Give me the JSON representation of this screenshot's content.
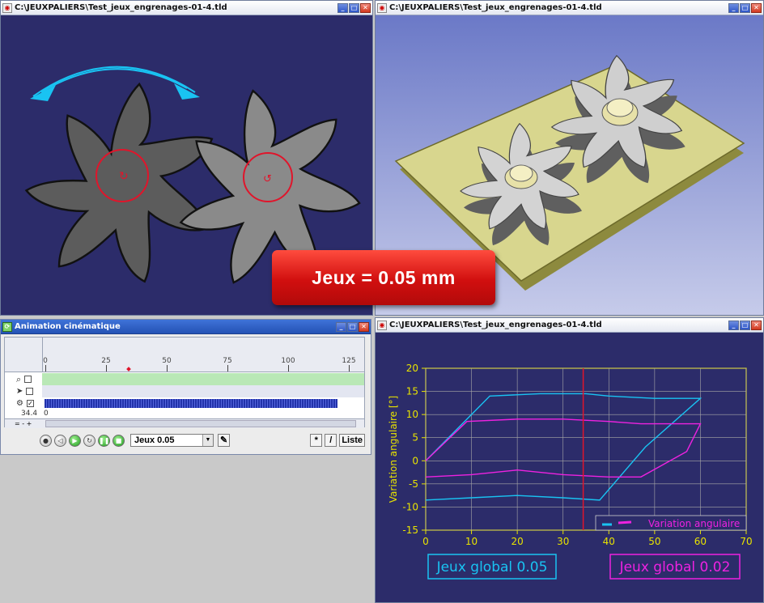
{
  "windows": {
    "left_title": "C:\\JEUXPALIERS\\Test_jeux_engrenages-01-4.tld",
    "right_title": "C:\\JEUXPALIERS\\Test_jeux_engrenages-01-4.tld",
    "graph_title": "C:\\JEUXPALIERS\\Test_jeux_engrenages-01-4.tld"
  },
  "banner": {
    "text": "Jeux = 0.05 mm"
  },
  "animation": {
    "title": "Animation cinématique",
    "ruler_ticks": [
      "0",
      "25",
      "50",
      "75",
      "100",
      "125"
    ],
    "current_value": "34.4",
    "row_value": "0",
    "scenario": "Jeux 0.05",
    "star_label": "*",
    "slash_label": "/",
    "list_label": "Liste"
  },
  "chart_data": {
    "type": "line",
    "ylabel": "Variation angulaire  [°]",
    "xlim": [
      0,
      70
    ],
    "ylim": [
      -15,
      20
    ],
    "x_ticks": [
      "0",
      "10",
      "20",
      "30",
      "40",
      "50",
      "60",
      "70"
    ],
    "y_ticks": [
      "20",
      "15",
      "10",
      "5",
      "0",
      "-5",
      "-10",
      "-15"
    ],
    "legend": "Variation angulaire",
    "cursor_x": 34.4,
    "series": [
      {
        "color": "#19c3f2",
        "x": [
          0,
          14,
          25,
          35,
          40,
          50,
          60,
          60,
          48,
          38,
          30,
          20,
          10,
          0
        ],
        "y": [
          0,
          14,
          14.5,
          14.5,
          14,
          13.5,
          13.5,
          13.5,
          3,
          -8.5,
          -8,
          -7.5,
          -8,
          -8.5
        ]
      },
      {
        "color": "#ee22e0",
        "x": [
          0,
          9,
          20,
          30,
          40,
          47,
          60,
          60,
          57,
          47,
          40,
          30,
          20,
          10,
          0
        ],
        "y": [
          0,
          8.5,
          9,
          9,
          8.5,
          8,
          8,
          8,
          2,
          -3.5,
          -3.5,
          -3,
          -2,
          -3,
          -3.5
        ]
      }
    ],
    "labels": [
      {
        "text": "Jeux global  0.05",
        "color": "#19c3f2"
      },
      {
        "text": "Jeux global  0.02",
        "color": "#ee22e0"
      }
    ]
  }
}
